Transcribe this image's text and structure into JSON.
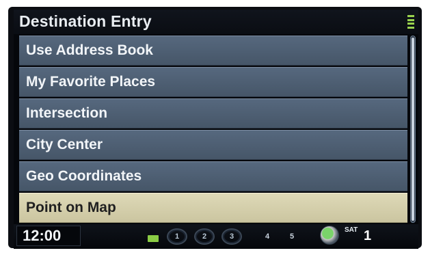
{
  "header": {
    "title": "Destination Entry",
    "signal_icon": "signal-strength-icon"
  },
  "menu": {
    "items": [
      {
        "label": "Use Address Book",
        "selected": false
      },
      {
        "label": "My Favorite Places",
        "selected": false
      },
      {
        "label": "Intersection",
        "selected": false
      },
      {
        "label": "City Center",
        "selected": false
      },
      {
        "label": "Geo Coordinates",
        "selected": false
      },
      {
        "label": "Point on Map",
        "selected": true
      }
    ],
    "colors": {
      "item": "#4e5f73",
      "selected": "#d6d0ad",
      "text": "#f2f5f8",
      "selected_text": "#202020"
    }
  },
  "status": {
    "time": "12:00",
    "voice_icon": "voice-control-icon",
    "presets": [
      "1",
      "2",
      "3",
      "4",
      "5"
    ],
    "disc_icon": "disc-icon",
    "band": "SAT",
    "channel": "1"
  }
}
